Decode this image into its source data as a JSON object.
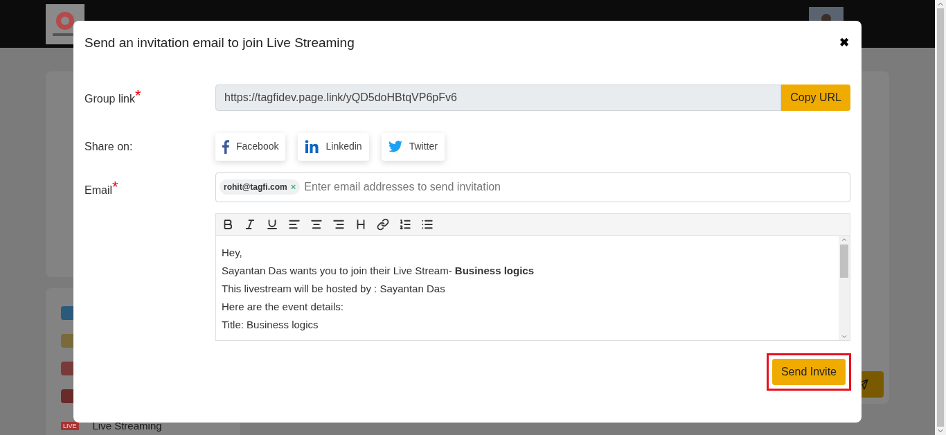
{
  "background": {
    "sidebar_items": [
      {
        "badge": "LIVE",
        "label": "Live Streaming"
      }
    ]
  },
  "dialog": {
    "title": "Send an invitation email to join Live Streaming",
    "close": "✖",
    "group_link": {
      "label": "Group link",
      "required_mark": "*",
      "value": "https://tagfidev.page.link/yQD5doHBtqVP6pFv6",
      "button": "Copy URL"
    },
    "share": {
      "label": "Share on:",
      "buttons": [
        {
          "kind": "facebook",
          "label": "Facebook"
        },
        {
          "kind": "linkedin",
          "label": "Linkedin"
        },
        {
          "kind": "twitter",
          "label": "Twitter"
        }
      ]
    },
    "email": {
      "label": "Email",
      "required_mark": "*",
      "tags": [
        {
          "text": "rohit@tagfi.com",
          "remove": "×"
        }
      ],
      "placeholder": "Enter email addresses to send invitation"
    },
    "editor": {
      "toolbar": [
        {
          "kind": "bold"
        },
        {
          "kind": "italic"
        },
        {
          "kind": "underline"
        },
        {
          "kind": "align-left"
        },
        {
          "kind": "align-center"
        },
        {
          "kind": "align-right"
        },
        {
          "kind": "heading"
        },
        {
          "kind": "link"
        },
        {
          "kind": "ordered-list"
        },
        {
          "kind": "bullet-list"
        }
      ],
      "lines": [
        "Hey,",
        "Sayantan Das wants you to join their Live Stream- **Business logics**",
        "This livestream will be hosted by : Sayantan Das",
        "Here are the event details:",
        "Title: Business logics"
      ]
    },
    "send_button": {
      "label": "Send Invite",
      "highlighted": true
    }
  }
}
